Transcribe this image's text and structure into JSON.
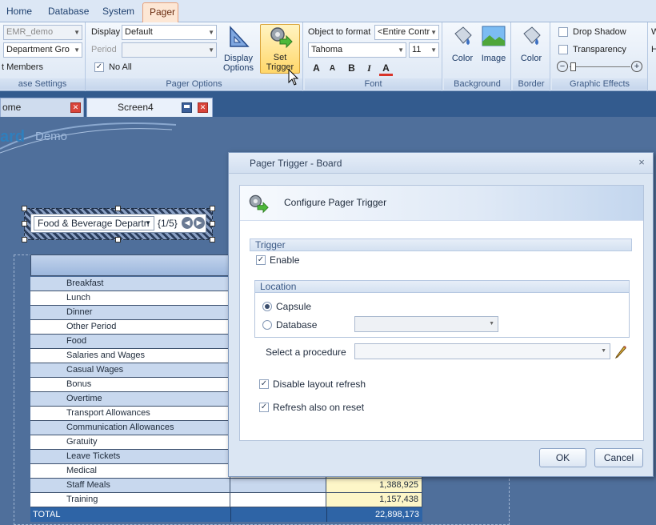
{
  "ribbon_tabs": [
    {
      "label": "Home"
    },
    {
      "label": "Database"
    },
    {
      "label": "System"
    },
    {
      "label": "Pager"
    }
  ],
  "ribbon": {
    "database_settings": {
      "db_value": "EMR_demo",
      "dept_value": "Department Gro",
      "members_label": "t Members",
      "group_label": "ase Settings"
    },
    "pager_options": {
      "display_label": "Display",
      "display_value": "Default",
      "period_label": "Period",
      "period_value": "",
      "noall_label": "No All",
      "noall_checked": "✓",
      "display_options_label": "Display Options",
      "set_trigger_label": "Set Trigger",
      "group_label": "Pager Options"
    },
    "font": {
      "object_label": "Object to format",
      "object_value": "<Entire Contr",
      "font_name": "Tahoma",
      "font_size": "11",
      "grow": "A",
      "shrink": "A",
      "bold": "B",
      "italic": "I",
      "color": "A",
      "group_label": "Font"
    },
    "background": {
      "color_label": "Color",
      "image_label": "Image",
      "group_label": "Background"
    },
    "border": {
      "color_label": "Color",
      "group_label": "Border"
    },
    "effects": {
      "shadow_label": "Drop Shadow",
      "transparency_label": "Transparency",
      "minus": "−",
      "plus": "+",
      "group_label": "Graphic Effects"
    },
    "overflow": {
      "c1": "W",
      "c2": "H"
    }
  },
  "doc_tabs": [
    {
      "label": "ome"
    },
    {
      "label": "Screen4"
    }
  ],
  "canvas": {
    "logo_text": "ard",
    "demo_text": "Demo",
    "pager_value": "Food & Beverage Departn",
    "pager_count": "{1/5}",
    "rows": [
      {
        "label": "Breakfast",
        "value": ""
      },
      {
        "label": "Lunch",
        "value": ""
      },
      {
        "label": "Dinner",
        "value": ""
      },
      {
        "label": "Other Period",
        "value": ""
      },
      {
        "label": "Food",
        "value": ""
      },
      {
        "label": "Salaries and Wages",
        "value": ""
      },
      {
        "label": "Casual Wages",
        "value": ""
      },
      {
        "label": "Bonus",
        "value": ""
      },
      {
        "label": "Overtime",
        "value": ""
      },
      {
        "label": "Transport Allowances",
        "value": ""
      },
      {
        "label": "Communication Allowances",
        "value": ""
      },
      {
        "label": "Gratuity",
        "value": ""
      },
      {
        "label": "Leave Tickets",
        "value": ""
      },
      {
        "label": "Medical",
        "value": ""
      },
      {
        "label": "Staff Meals",
        "value": "1,388,925"
      },
      {
        "label": "Training",
        "value": "1,157,438"
      }
    ],
    "total": {
      "label": "TOTAL",
      "value": "22,898,173"
    }
  },
  "dialog": {
    "title": "Pager Trigger - Board",
    "close": "×",
    "header": "Configure Pager Trigger",
    "trigger_section": "Trigger",
    "enable_label": "Enable",
    "location_section": "Location",
    "capsule_label": "Capsule",
    "database_label": "Database",
    "procedure_label": "Select a procedure",
    "disable_refresh_label": "Disable layout refresh",
    "refresh_reset_label": "Refresh also on reset",
    "ok_label": "OK",
    "cancel_label": "Cancel",
    "check": "✓"
  }
}
